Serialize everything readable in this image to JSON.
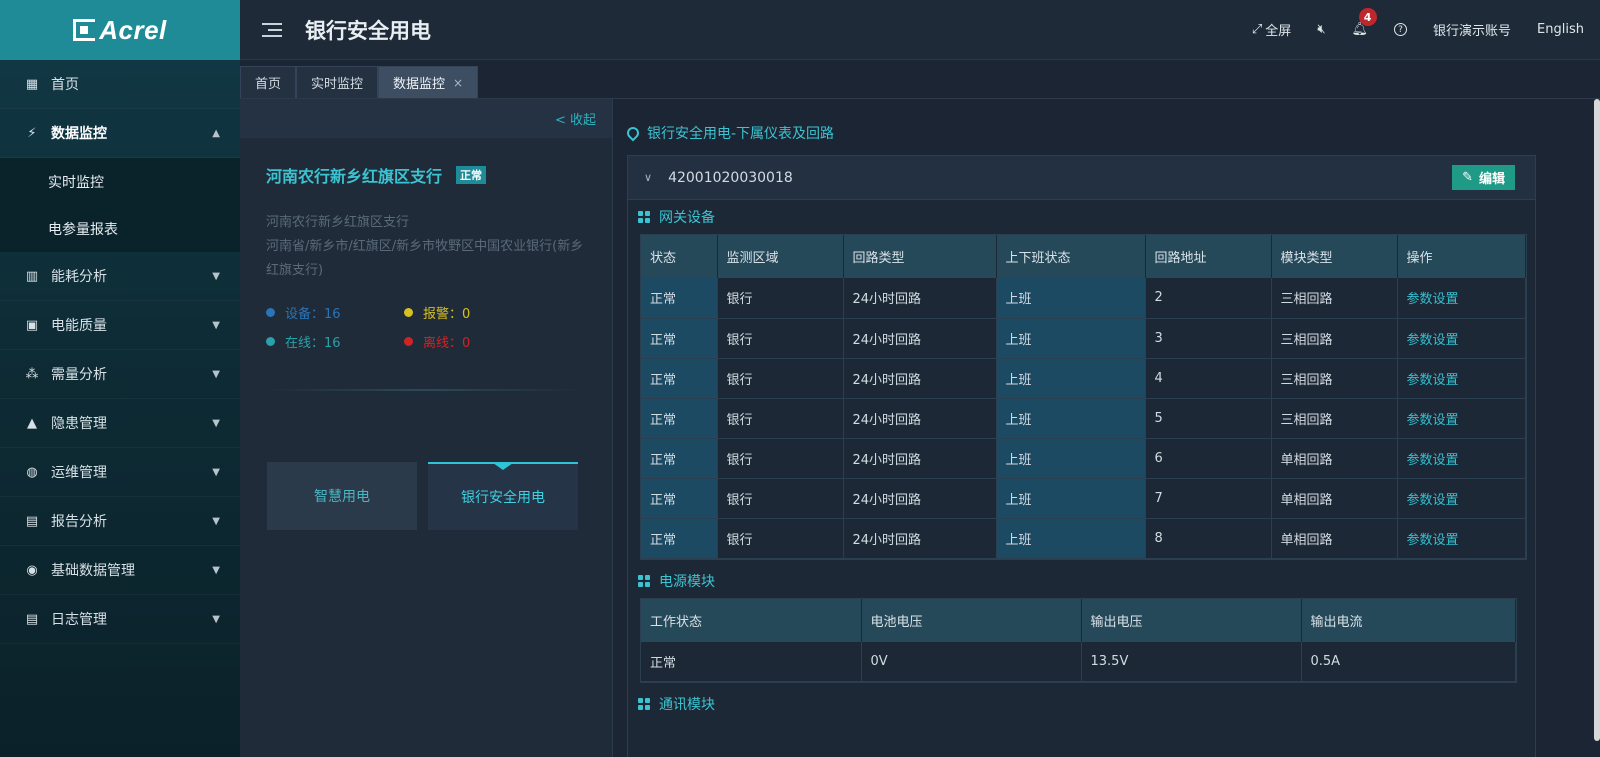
{
  "sidebar": {
    "logo_text": "Acrel",
    "items": [
      {
        "label": "首页",
        "icon": "home-icon"
      },
      {
        "label": "数据监控",
        "icon": "monitor-icon",
        "open": true,
        "sub": [
          "实时监控",
          "电参量报表"
        ]
      },
      {
        "label": "能耗分析",
        "icon": "bar-chart-icon"
      },
      {
        "label": "电能质量",
        "icon": "calendar-icon"
      },
      {
        "label": "需量分析",
        "icon": "cluster-icon"
      },
      {
        "label": "隐患管理",
        "icon": "warning-icon"
      },
      {
        "label": "运维管理",
        "icon": "globe-icon"
      },
      {
        "label": "报告分析",
        "icon": "report-icon"
      },
      {
        "label": "基础数据管理",
        "icon": "database-icon"
      },
      {
        "label": "日志管理",
        "icon": "log-icon"
      }
    ]
  },
  "header": {
    "title": "银行安全用电",
    "fullscreen_label": "全屏",
    "notification_count": "4",
    "account_label": "银行演示账号",
    "language_label": "English"
  },
  "tabs": [
    {
      "label": "首页"
    },
    {
      "label": "实时监控"
    },
    {
      "label": "数据监控",
      "active": true,
      "close": "×"
    }
  ],
  "left_panel": {
    "collapse_label": "< 收起",
    "branch_name": "河南农行新乡红旗区支行",
    "status_tag": "正常",
    "address_line1": "河南农行新乡红旗区支行",
    "address_line2": "河南省/新乡市/红旗区/新乡市牧野区中国农业银行(新乡红旗支行)",
    "stats": {
      "device": "设备：16",
      "alarm": "报警：0",
      "online": "在线：16",
      "offline": "离线：0"
    },
    "cards": [
      "智慧用电",
      "银行安全用电"
    ],
    "colors": {
      "device": "#2a74b8",
      "alarm": "#d8c020",
      "online": "#2aa0a8",
      "offline": "#d02424"
    }
  },
  "right_panel": {
    "section_title": "银行安全用电-下属仪表及回路",
    "device_id": "42001020030018",
    "edit_label": "编辑",
    "gateway": {
      "title": "网关设备",
      "columns": [
        "状态",
        "监测区域",
        "回路类型",
        "上下班状态",
        "回路地址",
        "模块类型",
        "操作"
      ],
      "rows": [
        [
          "正常",
          "银行",
          "24小时回路",
          "上班",
          "2",
          "三相回路",
          "参数设置"
        ],
        [
          "正常",
          "银行",
          "24小时回路",
          "上班",
          "3",
          "三相回路",
          "参数设置"
        ],
        [
          "正常",
          "银行",
          "24小时回路",
          "上班",
          "4",
          "三相回路",
          "参数设置"
        ],
        [
          "正常",
          "银行",
          "24小时回路",
          "上班",
          "5",
          "三相回路",
          "参数设置"
        ],
        [
          "正常",
          "银行",
          "24小时回路",
          "上班",
          "6",
          "单相回路",
          "参数设置"
        ],
        [
          "正常",
          "银行",
          "24小时回路",
          "上班",
          "7",
          "单相回路",
          "参数设置"
        ],
        [
          "正常",
          "银行",
          "24小时回路",
          "上班",
          "8",
          "单相回路",
          "参数设置"
        ]
      ]
    },
    "power": {
      "title": "电源模块",
      "columns": [
        "工作状态",
        "电池电压",
        "输出电压",
        "输出电流"
      ],
      "rows": [
        [
          "正常",
          "0V",
          "13.5V",
          "0.5A"
        ]
      ]
    },
    "comm": {
      "title": "通讯模块"
    }
  }
}
